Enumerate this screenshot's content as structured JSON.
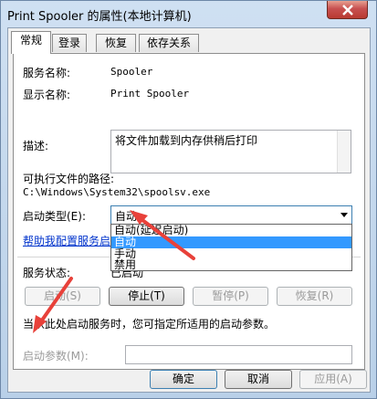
{
  "window": {
    "title": "Print Spooler 的属性(本地计算机)"
  },
  "tabs": [
    {
      "label": "常规",
      "active": true
    },
    {
      "label": "登录",
      "active": false
    },
    {
      "label": "恢复",
      "active": false
    },
    {
      "label": "依存关系",
      "active": false
    }
  ],
  "general": {
    "service_name_label": "服务名称:",
    "service_name_value": "Spooler",
    "display_name_label": "显示名称:",
    "display_name_value": "Print Spooler",
    "description_label": "描述:",
    "description_value": "将文件加载到内存供稍后打印",
    "exe_path_label": "可执行文件的路径:",
    "exe_path_value": "C:\\Windows\\System32\\spoolsv.exe",
    "startup_type_label": "启动类型(E):",
    "startup_type_value": "自动",
    "startup_options": [
      "自动(延迟启动)",
      "自动",
      "手动",
      "禁用"
    ],
    "help_link": "帮助我配置服务启动",
    "service_status_label": "服务状态:",
    "service_status_value": "已启动",
    "start_hint": "当从此处启动服务时，您可指定所适用的启动参数。",
    "start_params_label": "启动参数(M):",
    "start_params_value": ""
  },
  "service_buttons": {
    "start": "启动(S)",
    "stop": "停止(T)",
    "pause": "暂停(P)",
    "resume": "恢复(R)"
  },
  "footer": {
    "ok": "确定",
    "cancel": "取消",
    "apply": "应用(A)"
  },
  "colors": {
    "selection": "#3399ff",
    "link": "#0033cc",
    "annotation_arrow": "#e8413a"
  }
}
